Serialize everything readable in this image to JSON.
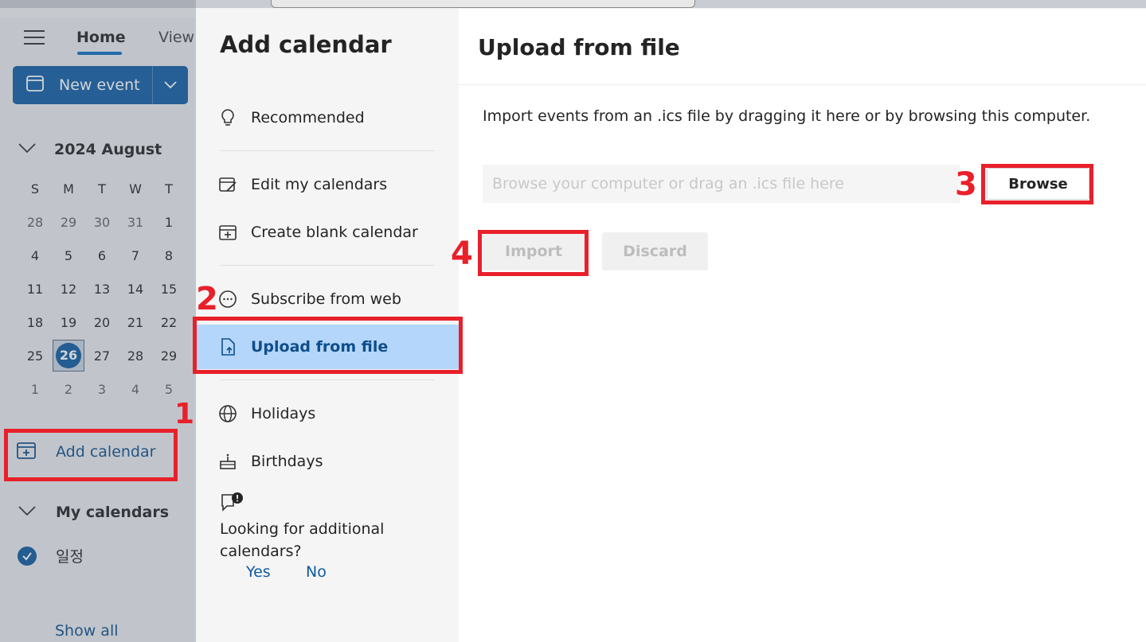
{
  "app": {
    "tabs": [
      "Home",
      "View"
    ],
    "new_event_label": "New event",
    "mini_calendar": {
      "month_label": "2024 August",
      "weekday_headers": [
        "S",
        "M",
        "T",
        "W",
        "T"
      ],
      "weeks": [
        [
          "28",
          "29",
          "30",
          "31",
          "1"
        ],
        [
          "4",
          "5",
          "6",
          "7",
          "8"
        ],
        [
          "11",
          "12",
          "13",
          "14",
          "15"
        ],
        [
          "18",
          "19",
          "20",
          "21",
          "22"
        ],
        [
          "25",
          "26",
          "27",
          "28",
          "29"
        ],
        [
          "1",
          "2",
          "3",
          "4",
          "5"
        ]
      ],
      "today": "26"
    },
    "add_calendar_label": "Add calendar",
    "my_calendars_label": "My calendars",
    "my_calendar_items": [
      "일정"
    ],
    "show_all_label": "Show all"
  },
  "dialog": {
    "nav_title": "Add calendar",
    "nav_items": [
      {
        "label": "Recommended",
        "icon": "lightbulb-icon"
      },
      {
        "label": "Edit my calendars",
        "icon": "edit-calendar-icon"
      },
      {
        "label": "Create blank calendar",
        "icon": "calendar-add-icon"
      },
      {
        "label": "Subscribe from web",
        "icon": "web-icon"
      },
      {
        "label": "Upload from file",
        "icon": "file-upload-icon",
        "selected": true
      },
      {
        "label": "Holidays",
        "icon": "globe-icon"
      },
      {
        "label": "Birthdays",
        "icon": "cake-icon"
      }
    ],
    "feedback": {
      "question": "Looking for additional calendars?",
      "yes": "Yes",
      "no": "No"
    },
    "content": {
      "title": "Upload from file",
      "description": "Import events from an .ics file by dragging it here or by browsing this computer.",
      "file_input_placeholder": "Browse your computer or drag an .ics file here",
      "browse_label": "Browse",
      "import_label": "Import",
      "discard_label": "Discard"
    }
  },
  "annotations": [
    "1",
    "2",
    "3",
    "4"
  ],
  "colors": {
    "accent": "#0f6cbd",
    "selected_bg": "#b4d6fa",
    "annotation_red": "#e8202a"
  }
}
